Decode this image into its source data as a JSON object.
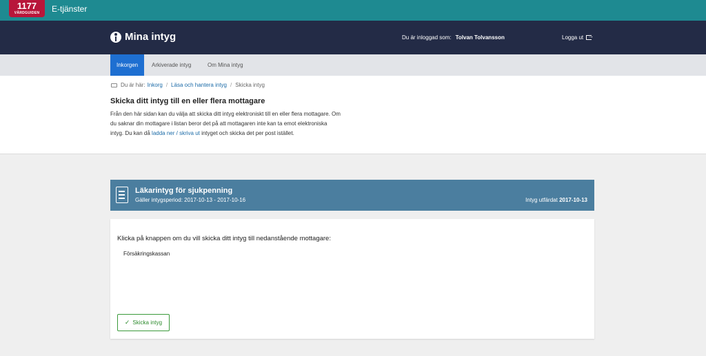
{
  "topbar": {
    "logo_number": "1177",
    "logo_sub": "VÅRDGUIDEN",
    "service": "E-tjänster"
  },
  "header": {
    "brand": "Mina intyg",
    "logged_in_label": "Du är inloggad som:",
    "user_name": "Tolvan Tolvansson",
    "logout_label": "Logga ut"
  },
  "tabs": [
    {
      "label": "Inkorgen",
      "active": true
    },
    {
      "label": "Arkiverade intyg",
      "active": false
    },
    {
      "label": "Om Mina intyg",
      "active": false
    }
  ],
  "breadcrumb": {
    "prefix": "Du är här:",
    "items": [
      "Inkorg",
      "Läsa och hantera intyg",
      "Skicka intyg"
    ]
  },
  "intro": {
    "title": "Skicka ditt intyg till en eller flera mottagare",
    "text_before_link": "Från den här sidan kan du välja att skicka ditt intyg elektroniskt till en eller flera mottagare. Om du saknar din mottagare i listan beror det på att mottagaren inte kan ta emot elektroniska intyg. Du kan då ",
    "link_text": "ladda ner / skriva ut",
    "text_after_link": " intyget och skicka det per post istället."
  },
  "certificate": {
    "title": "Läkarintyg för sjukpenning",
    "period": "Gäller intygsperiod: 2017-10-13 - 2017-10-16",
    "issued_label": "Intyg utfärdat",
    "issued_date": "2017-10-13",
    "icon": "document-icon"
  },
  "send_panel": {
    "prompt": "Klicka på knappen om du vill skicka ditt intyg till nedanstående mottagare:",
    "recipient": "Försäkringskassan",
    "button_label": "Skicka intyg",
    "button_icon": "check-icon"
  }
}
